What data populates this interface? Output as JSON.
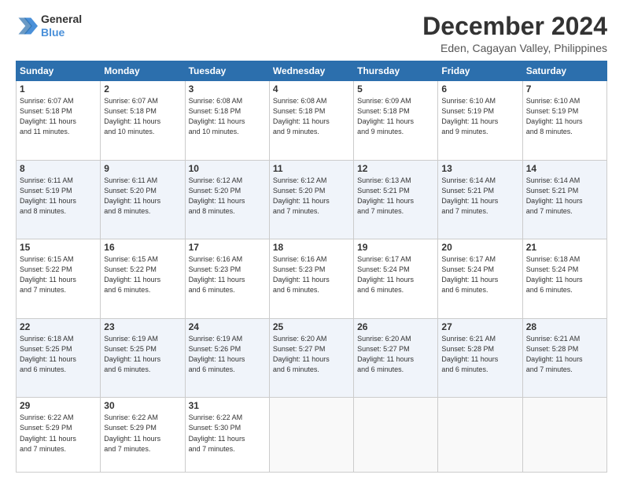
{
  "logo": {
    "line1": "General",
    "line2": "Blue"
  },
  "title": "December 2024",
  "subtitle": "Eden, Cagayan Valley, Philippines",
  "weekdays": [
    "Sunday",
    "Monday",
    "Tuesday",
    "Wednesday",
    "Thursday",
    "Friday",
    "Saturday"
  ],
  "weeks": [
    [
      {
        "day": "1",
        "sunrise": "6:07 AM",
        "sunset": "5:18 PM",
        "daylight": "11 hours and 11 minutes."
      },
      {
        "day": "2",
        "sunrise": "6:07 AM",
        "sunset": "5:18 PM",
        "daylight": "11 hours and 10 minutes."
      },
      {
        "day": "3",
        "sunrise": "6:08 AM",
        "sunset": "5:18 PM",
        "daylight": "11 hours and 10 minutes."
      },
      {
        "day": "4",
        "sunrise": "6:08 AM",
        "sunset": "5:18 PM",
        "daylight": "11 hours and 9 minutes."
      },
      {
        "day": "5",
        "sunrise": "6:09 AM",
        "sunset": "5:18 PM",
        "daylight": "11 hours and 9 minutes."
      },
      {
        "day": "6",
        "sunrise": "6:10 AM",
        "sunset": "5:19 PM",
        "daylight": "11 hours and 9 minutes."
      },
      {
        "day": "7",
        "sunrise": "6:10 AM",
        "sunset": "5:19 PM",
        "daylight": "11 hours and 8 minutes."
      }
    ],
    [
      {
        "day": "8",
        "sunrise": "6:11 AM",
        "sunset": "5:19 PM",
        "daylight": "11 hours and 8 minutes."
      },
      {
        "day": "9",
        "sunrise": "6:11 AM",
        "sunset": "5:20 PM",
        "daylight": "11 hours and 8 minutes."
      },
      {
        "day": "10",
        "sunrise": "6:12 AM",
        "sunset": "5:20 PM",
        "daylight": "11 hours and 8 minutes."
      },
      {
        "day": "11",
        "sunrise": "6:12 AM",
        "sunset": "5:20 PM",
        "daylight": "11 hours and 7 minutes."
      },
      {
        "day": "12",
        "sunrise": "6:13 AM",
        "sunset": "5:21 PM",
        "daylight": "11 hours and 7 minutes."
      },
      {
        "day": "13",
        "sunrise": "6:14 AM",
        "sunset": "5:21 PM",
        "daylight": "11 hours and 7 minutes."
      },
      {
        "day": "14",
        "sunrise": "6:14 AM",
        "sunset": "5:21 PM",
        "daylight": "11 hours and 7 minutes."
      }
    ],
    [
      {
        "day": "15",
        "sunrise": "6:15 AM",
        "sunset": "5:22 PM",
        "daylight": "11 hours and 7 minutes."
      },
      {
        "day": "16",
        "sunrise": "6:15 AM",
        "sunset": "5:22 PM",
        "daylight": "11 hours and 6 minutes."
      },
      {
        "day": "17",
        "sunrise": "6:16 AM",
        "sunset": "5:23 PM",
        "daylight": "11 hours and 6 minutes."
      },
      {
        "day": "18",
        "sunrise": "6:16 AM",
        "sunset": "5:23 PM",
        "daylight": "11 hours and 6 minutes."
      },
      {
        "day": "19",
        "sunrise": "6:17 AM",
        "sunset": "5:24 PM",
        "daylight": "11 hours and 6 minutes."
      },
      {
        "day": "20",
        "sunrise": "6:17 AM",
        "sunset": "5:24 PM",
        "daylight": "11 hours and 6 minutes."
      },
      {
        "day": "21",
        "sunrise": "6:18 AM",
        "sunset": "5:24 PM",
        "daylight": "11 hours and 6 minutes."
      }
    ],
    [
      {
        "day": "22",
        "sunrise": "6:18 AM",
        "sunset": "5:25 PM",
        "daylight": "11 hours and 6 minutes."
      },
      {
        "day": "23",
        "sunrise": "6:19 AM",
        "sunset": "5:25 PM",
        "daylight": "11 hours and 6 minutes."
      },
      {
        "day": "24",
        "sunrise": "6:19 AM",
        "sunset": "5:26 PM",
        "daylight": "11 hours and 6 minutes."
      },
      {
        "day": "25",
        "sunrise": "6:20 AM",
        "sunset": "5:27 PM",
        "daylight": "11 hours and 6 minutes."
      },
      {
        "day": "26",
        "sunrise": "6:20 AM",
        "sunset": "5:27 PM",
        "daylight": "11 hours and 6 minutes."
      },
      {
        "day": "27",
        "sunrise": "6:21 AM",
        "sunset": "5:28 PM",
        "daylight": "11 hours and 6 minutes."
      },
      {
        "day": "28",
        "sunrise": "6:21 AM",
        "sunset": "5:28 PM",
        "daylight": "11 hours and 7 minutes."
      }
    ],
    [
      {
        "day": "29",
        "sunrise": "6:22 AM",
        "sunset": "5:29 PM",
        "daylight": "11 hours and 7 minutes."
      },
      {
        "day": "30",
        "sunrise": "6:22 AM",
        "sunset": "5:29 PM",
        "daylight": "11 hours and 7 minutes."
      },
      {
        "day": "31",
        "sunrise": "6:22 AM",
        "sunset": "5:30 PM",
        "daylight": "11 hours and 7 minutes."
      },
      null,
      null,
      null,
      null
    ]
  ]
}
